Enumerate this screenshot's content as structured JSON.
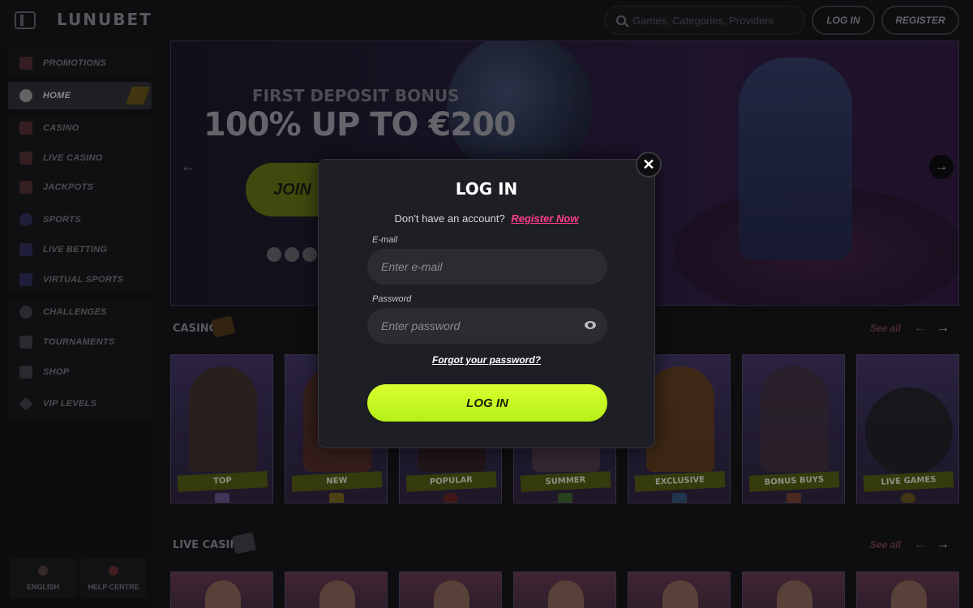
{
  "header": {
    "logo": "LUNUBET",
    "search_placeholder": "Games, Categories, Providers",
    "login_label": "LOG IN",
    "register_label": "REGISTER"
  },
  "sidebar": {
    "items": [
      {
        "label": "PROMOTIONS",
        "icon": "gift-icon"
      },
      {
        "label": "HOME",
        "icon": "home-icon",
        "active": true
      },
      {
        "label": "CASINO",
        "icon": "casino-icon"
      },
      {
        "label": "LIVE CASINO",
        "icon": "cards-icon"
      },
      {
        "label": "JACKPOTS",
        "icon": "jackpot-icon"
      },
      {
        "label": "SPORTS",
        "icon": "ball-icon"
      },
      {
        "label": "LIVE BETTING",
        "icon": "live-icon"
      },
      {
        "label": "VIRTUAL SPORTS",
        "icon": "virtual-icon"
      },
      {
        "label": "CHALLENGES",
        "icon": "challenge-icon"
      },
      {
        "label": "TOURNAMENTS",
        "icon": "trophy-icon"
      },
      {
        "label": "SHOP",
        "icon": "shop-icon"
      },
      {
        "label": "VIP LEVELS",
        "icon": "diamond-icon"
      }
    ],
    "bottom": {
      "language": "ENGLISH",
      "help": "HELP CENTRE"
    }
  },
  "banner": {
    "subtitle": "FIRST DEPOSIT BONUS",
    "title": "100% UP TO €200",
    "cta": "JOIN"
  },
  "casino": {
    "label": "CASINO",
    "see_all": "See all",
    "cards": [
      "TOP",
      "NEW",
      "POPULAR",
      "SUMMER",
      "EXCLUSIVE",
      "BONUS BUYS",
      "LIVE GAMES"
    ]
  },
  "live_casino": {
    "label": "LIVE CASINO",
    "see_all": "See all"
  },
  "modal": {
    "title": "LOG IN",
    "no_account": "Don't have an account?",
    "register_link": "Register Now",
    "email_label": "E-mail",
    "email_placeholder": "Enter e-mail",
    "password_label": "Password",
    "password_placeholder": "Enter password",
    "forgot": "Forgot your password?",
    "submit": "LOG IN"
  },
  "colors": {
    "accent": "#c8fb24",
    "link": "#ff3f8a",
    "background": "#141417"
  }
}
